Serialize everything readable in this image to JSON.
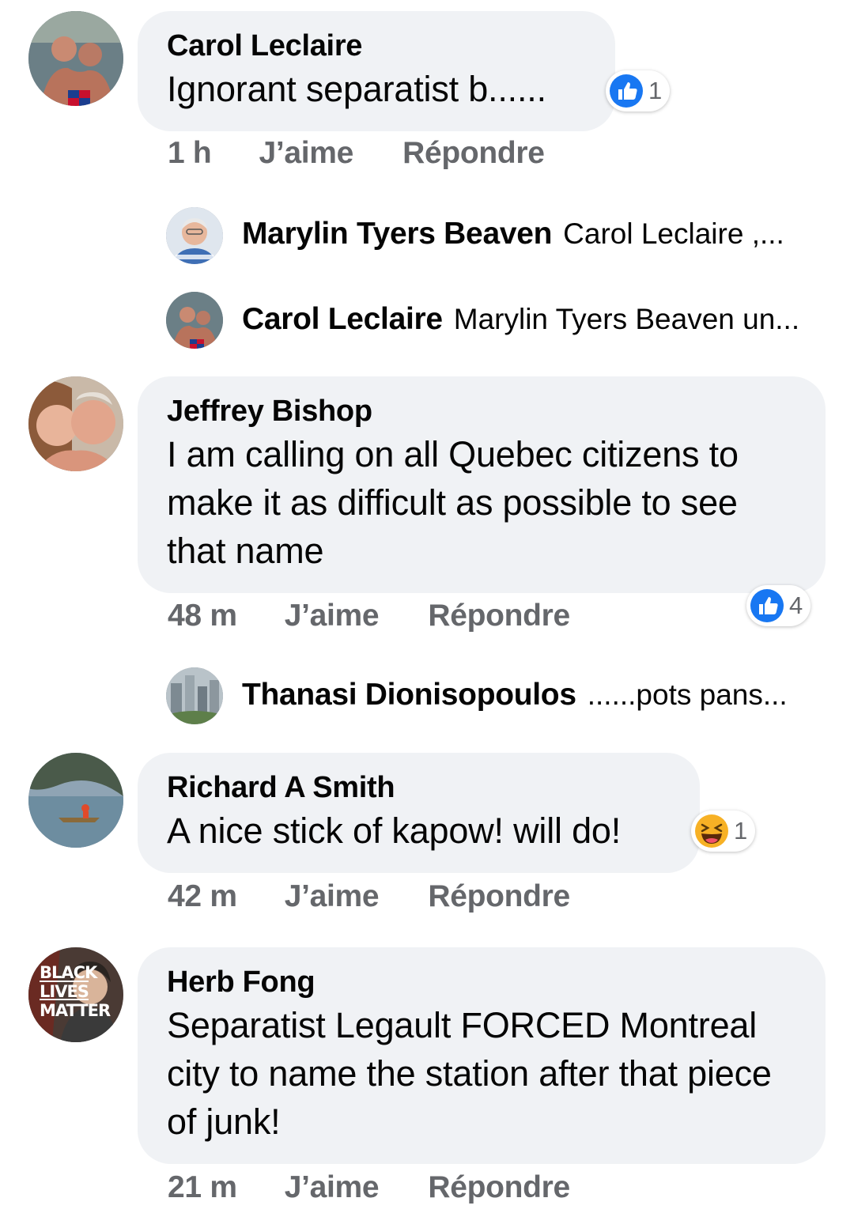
{
  "comments": [
    {
      "name": "Carol Leclaire",
      "text": "Ignorant separatist b......",
      "time": "1 h",
      "like_label": "J’aime",
      "reply_label": "Répondre",
      "reaction": {
        "type": "like",
        "count": "1"
      },
      "replies": [
        {
          "name": "Marylin Tyers Beaven",
          "text": "Carol Leclaire ,..."
        },
        {
          "name": "Carol Leclaire",
          "text": "Marylin Tyers Beaven un..."
        }
      ]
    },
    {
      "name": "Jeffrey Bishop",
      "text": "I am calling on all Quebec citizens to make it as difficult as possible to see that name",
      "time": "48 m",
      "like_label": "J’aime",
      "reply_label": "Répondre",
      "reaction": {
        "type": "like",
        "count": "4"
      },
      "replies": [
        {
          "name": "Thanasi Dionisopoulos",
          "text": "......pots pans..."
        }
      ]
    },
    {
      "name": "Richard A Smith",
      "text": "A nice stick of kapow! will do!",
      "time": "42 m",
      "like_label": "J’aime",
      "reply_label": "Répondre",
      "reaction": {
        "type": "haha",
        "count": "1"
      }
    },
    {
      "name": "Herb Fong",
      "text": "Separatist Legault FORCED Montreal city to name the station after that piece of junk!",
      "time": "21 m",
      "like_label": "J’aime",
      "reply_label": "Répondre",
      "avatar_overlay": [
        "BLACK",
        "LIVES",
        "MATTER"
      ]
    }
  ],
  "colors": {
    "bubble": "#f0f2f5",
    "meta": "#65676b",
    "like_blue": "#1877f2",
    "haha_yellow": "#f7b125"
  }
}
